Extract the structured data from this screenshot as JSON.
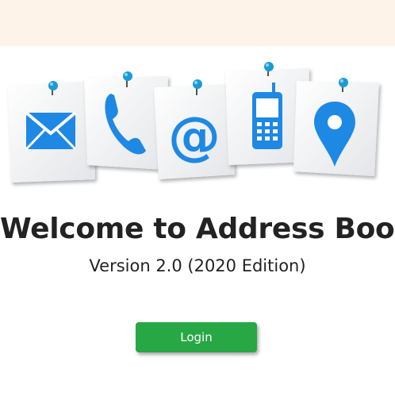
{
  "header": {},
  "hero": {
    "icons": [
      "envelope-icon",
      "phone-icon",
      "at-sign-icon",
      "mobile-phone-icon",
      "location-pin-icon"
    ],
    "accent_color": "#1e88e5",
    "pin_color": "#1a9bd7"
  },
  "main": {
    "title": "Welcome to Address Book",
    "subtitle": "Version 2.0 (2020 Edition)",
    "login_label": "Login"
  },
  "colors": {
    "top_band": "#fdf3e8",
    "login_button": "#28a745",
    "text": "#222222"
  }
}
